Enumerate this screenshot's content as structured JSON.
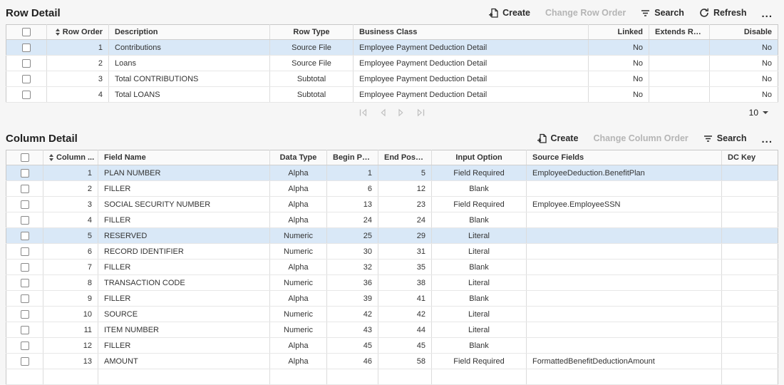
{
  "colors": {
    "selected-row": "#d9e8f7",
    "page-bg": "#f6f6f6",
    "head-bg": "#fafafa",
    "disabled-text": "#b5b5b5"
  },
  "row_detail": {
    "title": "Row Detail",
    "toolbar": {
      "create": "Create",
      "change_order": "Change Row Order",
      "search": "Search",
      "refresh": "Refresh",
      "more": "..."
    },
    "columns": [
      "Row Order",
      "Description",
      "Row Type",
      "Business Class",
      "Linked",
      "Extends Row",
      "Disable"
    ],
    "rows": [
      {
        "order": "1",
        "description": "Contributions",
        "row_type": "Source File",
        "business_class": "Employee Payment Deduction Detail",
        "linked": "No",
        "extends_row": "",
        "disable": "No",
        "selected": true
      },
      {
        "order": "2",
        "description": "Loans",
        "row_type": "Source File",
        "business_class": "Employee Payment Deduction Detail",
        "linked": "No",
        "extends_row": "",
        "disable": "No",
        "selected": false
      },
      {
        "order": "3",
        "description": "Total CONTRIBUTIONS",
        "row_type": "Subtotal",
        "business_class": "Employee Payment Deduction Detail",
        "linked": "No",
        "extends_row": "",
        "disable": "No",
        "selected": false
      },
      {
        "order": "4",
        "description": "Total LOANS",
        "row_type": "Subtotal",
        "business_class": "Employee Payment Deduction Detail",
        "linked": "No",
        "extends_row": "",
        "disable": "No",
        "selected": false
      }
    ],
    "pagination": {
      "page_size": "10"
    }
  },
  "column_detail": {
    "title": "Column Detail",
    "toolbar": {
      "create": "Create",
      "change_order": "Change Column Order",
      "search": "Search",
      "more": "..."
    },
    "columns": [
      "Column ...",
      "Field Name",
      "Data Type",
      "Begin Position",
      "End Position",
      "Input Option",
      "Source Fields",
      "DC Key"
    ],
    "rows": [
      {
        "order": "1",
        "field_name": "PLAN NUMBER",
        "data_type": "Alpha",
        "begin": "1",
        "end": "5",
        "input_option": "Field Required",
        "source_fields": "EmployeeDeduction.BenefitPlan",
        "dc_key": "",
        "selected": true
      },
      {
        "order": "2",
        "field_name": "FILLER",
        "data_type": "Alpha",
        "begin": "6",
        "end": "12",
        "input_option": "Blank",
        "source_fields": "",
        "dc_key": "",
        "selected": false
      },
      {
        "order": "3",
        "field_name": "SOCIAL SECURITY NUMBER",
        "data_type": "Alpha",
        "begin": "13",
        "end": "23",
        "input_option": "Field Required",
        "source_fields": "Employee.EmployeeSSN",
        "dc_key": "",
        "selected": false
      },
      {
        "order": "4",
        "field_name": "FILLER",
        "data_type": "Alpha",
        "begin": "24",
        "end": "24",
        "input_option": "Blank",
        "source_fields": "",
        "dc_key": "",
        "selected": false
      },
      {
        "order": "5",
        "field_name": "RESERVED",
        "data_type": "Numeric",
        "begin": "25",
        "end": "29",
        "input_option": "Literal",
        "source_fields": "",
        "dc_key": "",
        "selected": true
      },
      {
        "order": "6",
        "field_name": "RECORD IDENTIFIER",
        "data_type": "Numeric",
        "begin": "30",
        "end": "31",
        "input_option": "Literal",
        "source_fields": "",
        "dc_key": "",
        "selected": false
      },
      {
        "order": "7",
        "field_name": "FILLER",
        "data_type": "Alpha",
        "begin": "32",
        "end": "35",
        "input_option": "Blank",
        "source_fields": "",
        "dc_key": "",
        "selected": false
      },
      {
        "order": "8",
        "field_name": "TRANSACTION CODE",
        "data_type": "Numeric",
        "begin": "36",
        "end": "38",
        "input_option": "Literal",
        "source_fields": "",
        "dc_key": "",
        "selected": false
      },
      {
        "order": "9",
        "field_name": "FILLER",
        "data_type": "Alpha",
        "begin": "39",
        "end": "41",
        "input_option": "Blank",
        "source_fields": "",
        "dc_key": "",
        "selected": false
      },
      {
        "order": "10",
        "field_name": "SOURCE",
        "data_type": "Numeric",
        "begin": "42",
        "end": "42",
        "input_option": "Literal",
        "source_fields": "",
        "dc_key": "",
        "selected": false
      },
      {
        "order": "11",
        "field_name": "ITEM NUMBER",
        "data_type": "Numeric",
        "begin": "43",
        "end": "44",
        "input_option": "Literal",
        "source_fields": "",
        "dc_key": "",
        "selected": false
      },
      {
        "order": "12",
        "field_name": "FILLER",
        "data_type": "Alpha",
        "begin": "45",
        "end": "45",
        "input_option": "Blank",
        "source_fields": "",
        "dc_key": "",
        "selected": false
      },
      {
        "order": "13",
        "field_name": "AMOUNT",
        "data_type": "Alpha",
        "begin": "46",
        "end": "58",
        "input_option": "Field Required",
        "source_fields": "FormattedBenefitDeductionAmount",
        "dc_key": "",
        "selected": false
      }
    ]
  }
}
